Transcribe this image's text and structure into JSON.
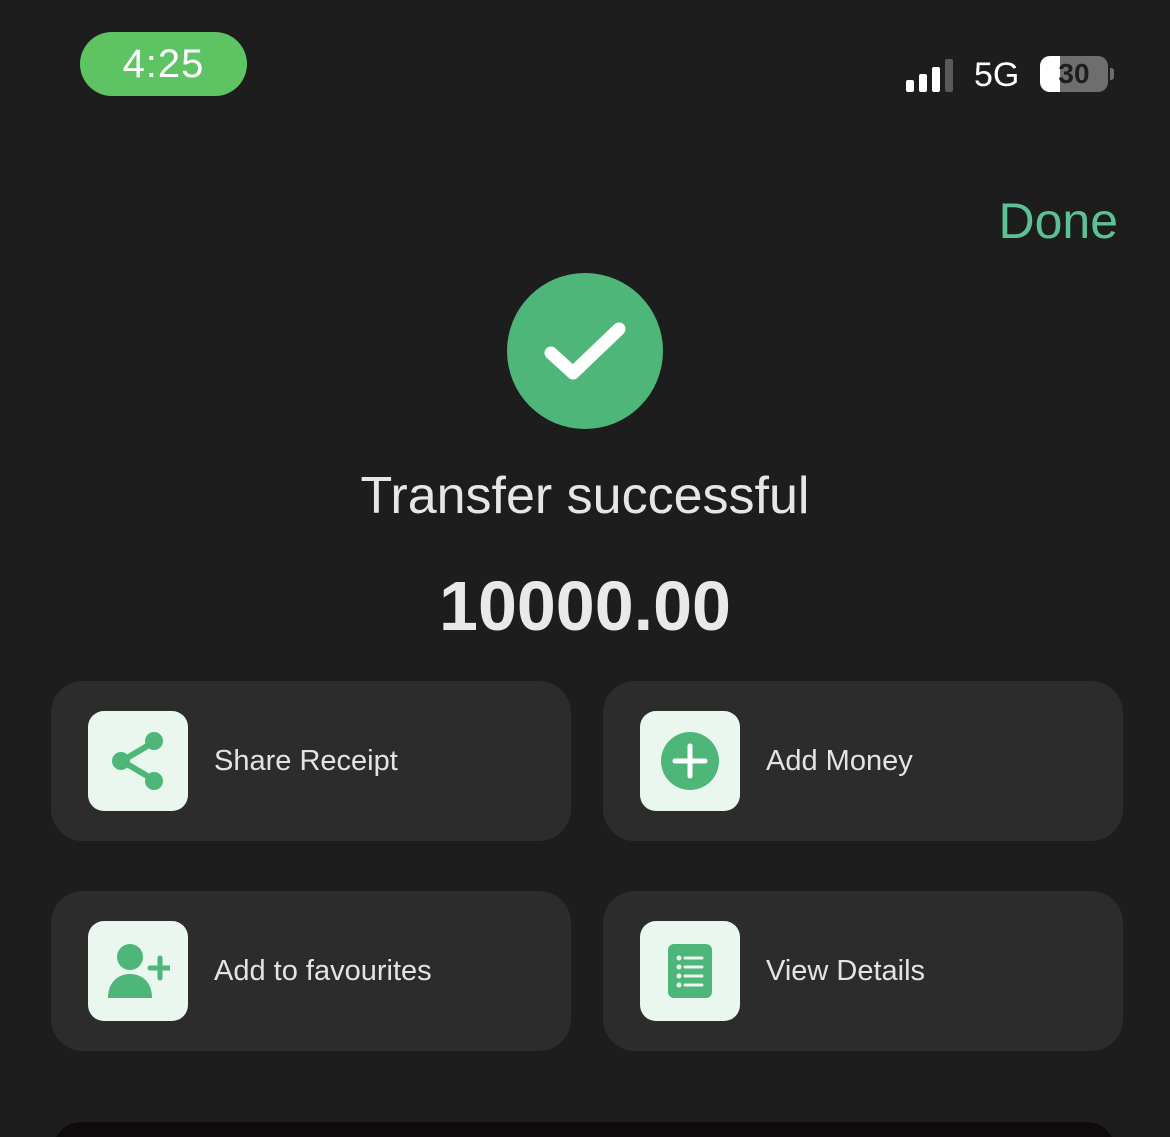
{
  "status_bar": {
    "time": "4:25",
    "network": "5G",
    "battery_level": "30",
    "battery_fraction": 0.3
  },
  "header": {
    "done_label": "Done"
  },
  "result": {
    "title": "Transfer successful",
    "amount": "10000.00"
  },
  "actions": [
    {
      "label": "Share Receipt",
      "icon": "share-icon"
    },
    {
      "label": "Add Money",
      "icon": "plus-circle-icon"
    },
    {
      "label": "Add to favourites",
      "icon": "add-user-icon"
    },
    {
      "label": "View Details",
      "icon": "list-document-icon"
    }
  ],
  "colors": {
    "accent": "#4fb679",
    "done_text": "#5cc196",
    "time_pill": "#5ec463",
    "background": "#1d1d1d",
    "card": "#2c2c2c",
    "icon_tile": "#e9f7ee"
  }
}
